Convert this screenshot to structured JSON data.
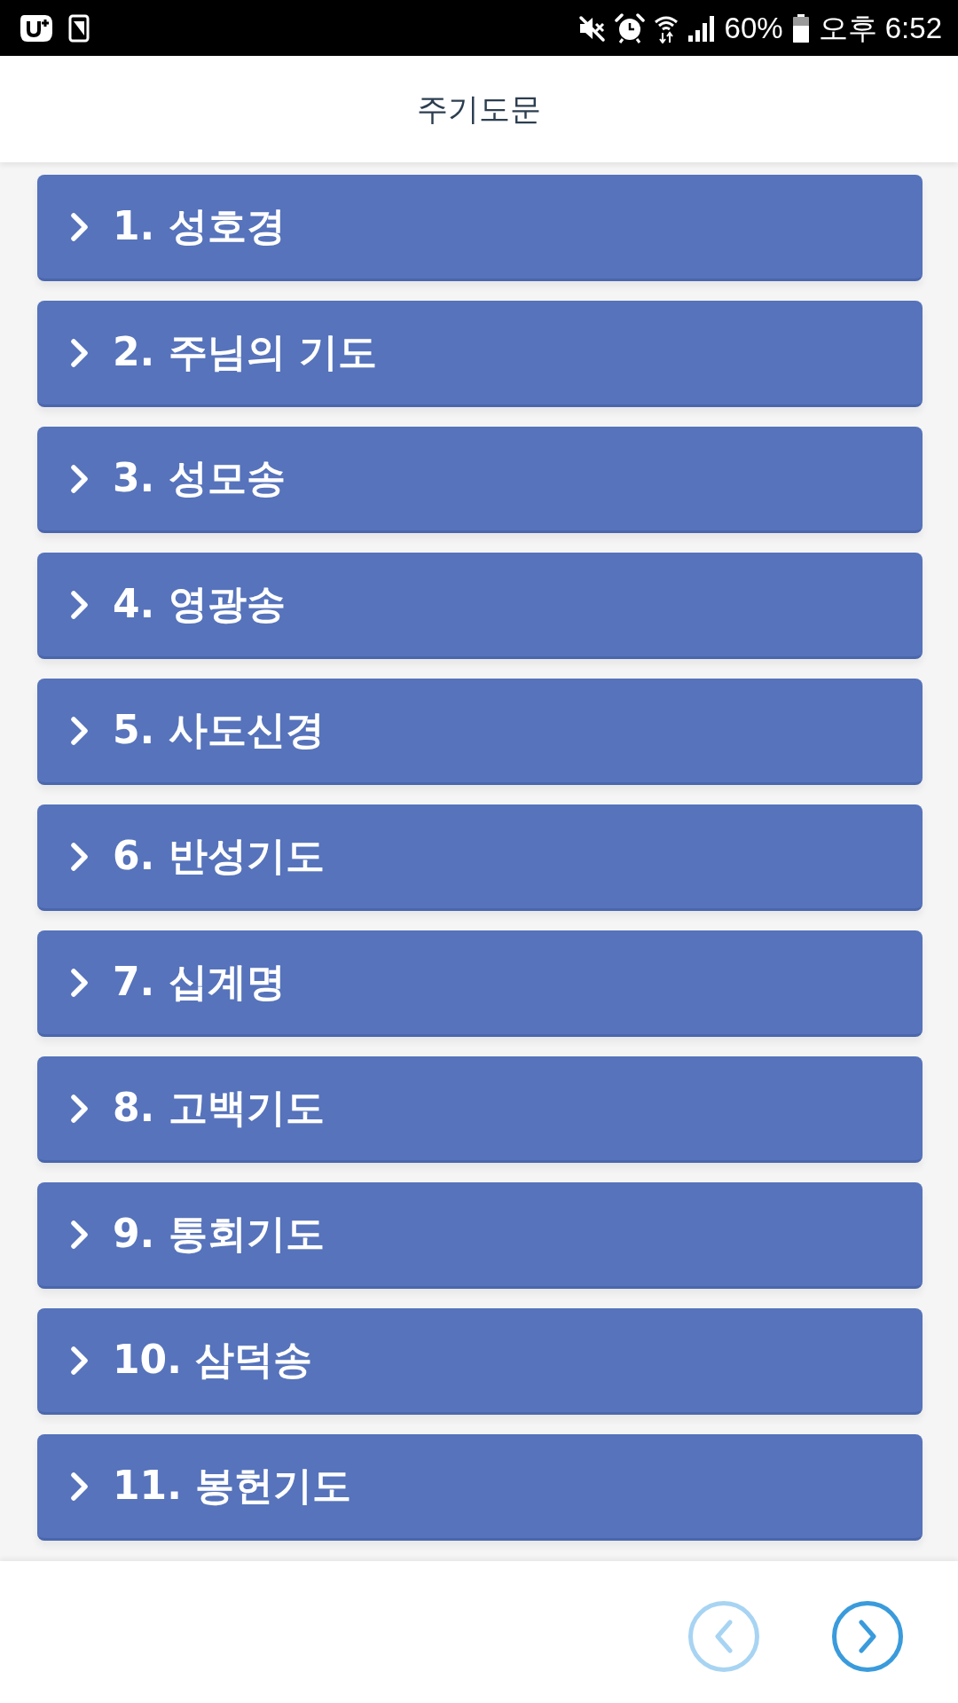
{
  "status_bar": {
    "battery": "60%",
    "time": "오후 6:52"
  },
  "header": {
    "title": "주기도문"
  },
  "items": [
    {
      "label": "1. 성호경",
      "expanded": false
    },
    {
      "label": "2. 주님의 기도",
      "expanded": false
    },
    {
      "label": "3. 성모송",
      "expanded": false
    },
    {
      "label": "4. 영광송",
      "expanded": false
    },
    {
      "label": "5. 사도신경",
      "expanded": false
    },
    {
      "label": "6. 반성기도",
      "expanded": false
    },
    {
      "label": "7. 십계명",
      "expanded": false
    },
    {
      "label": "8. 고백기도",
      "expanded": false
    },
    {
      "label": "9. 통회기도",
      "expanded": false
    },
    {
      "label": "10. 삼덕송",
      "expanded": false
    },
    {
      "label": "11. 봉헌기도",
      "expanded": false
    }
  ],
  "pager": [
    {
      "kind": "prev",
      "disabled": true
    },
    {
      "kind": "next",
      "disabled": false
    }
  ]
}
